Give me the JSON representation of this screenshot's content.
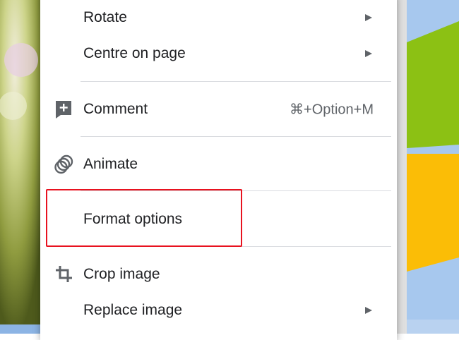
{
  "menu": {
    "items": [
      {
        "label": "Rotate",
        "has_submenu": true
      },
      {
        "label": "Centre on page",
        "has_submenu": true
      },
      {
        "label": "Comment",
        "shortcut": "⌘+Option+M",
        "icon": "add-comment-icon"
      },
      {
        "label": "Animate",
        "icon": "animate-icon"
      },
      {
        "label": "Format options",
        "highlighted": true
      },
      {
        "label": "Crop image",
        "icon": "crop-icon"
      },
      {
        "label": "Replace image",
        "has_submenu": true
      }
    ]
  },
  "colors": {
    "highlight_border": "#e8121f",
    "slide_green": "#8cc114",
    "slide_yellow": "#fbbd06",
    "slide_blue": "#a7c8ee"
  }
}
